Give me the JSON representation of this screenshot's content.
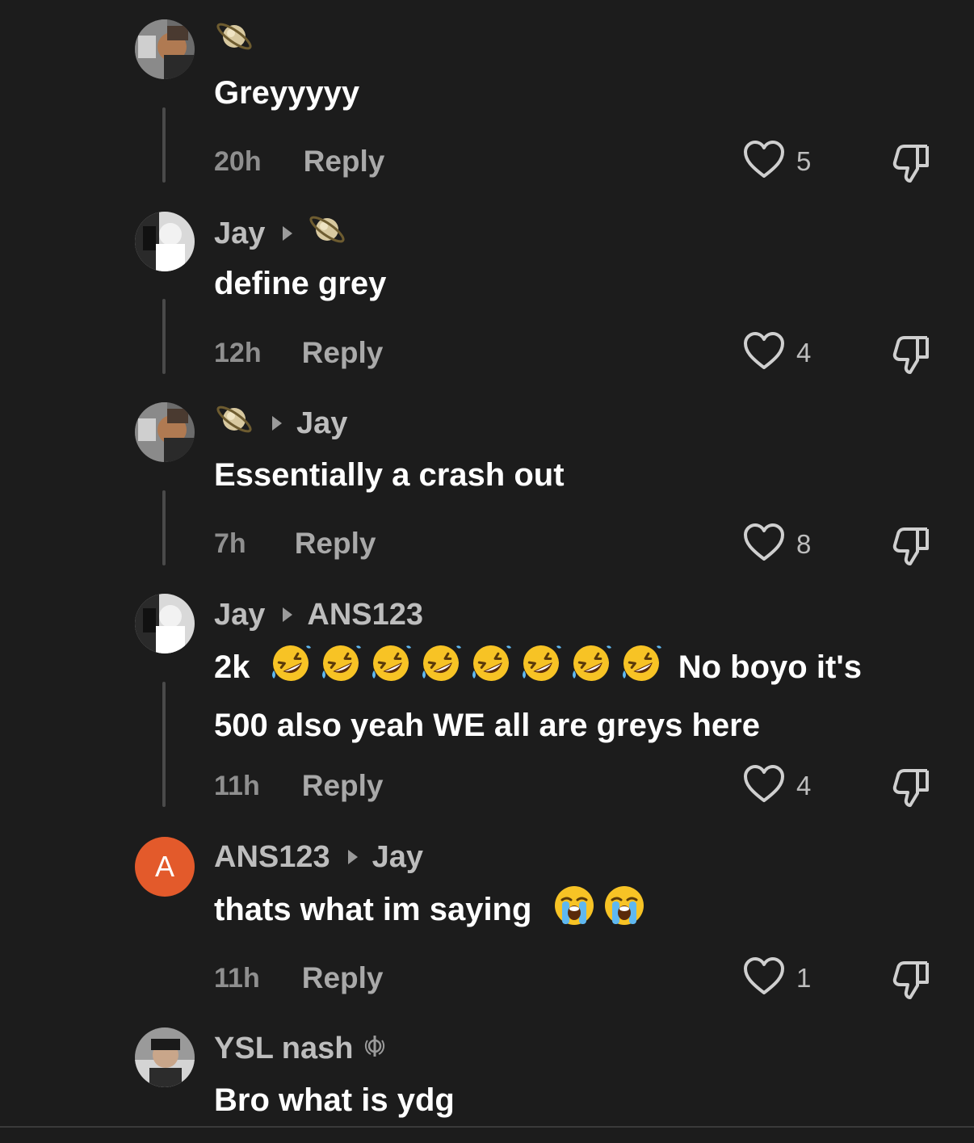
{
  "comments": [
    {
      "author": "",
      "author_icon": "planet-emoji",
      "text": "Greyyyyy",
      "time": "20h",
      "reply_label": "Reply",
      "likes": "5"
    },
    {
      "author": "Jay",
      "reply_to_icon": "planet-emoji",
      "text": "define grey",
      "time": "12h",
      "reply_label": "Reply",
      "likes": "4"
    },
    {
      "author_icon": "planet-emoji",
      "reply_to": "Jay",
      "text": "Essentially a crash out",
      "time": "7h",
      "reply_label": "Reply",
      "likes": "8"
    },
    {
      "author": "Jay",
      "reply_to": "ANS123",
      "text_prefix": "2k",
      "emoji_count": 8,
      "emoji_name": "rolling-on-floor-laughing",
      "text_suffix": "No boyo it's",
      "text_line2": "500 also yeah WE all are greys here",
      "time": "11h",
      "reply_label": "Reply",
      "likes": "4"
    },
    {
      "author": "ANS123",
      "avatar_letter": "A",
      "reply_to": "Jay",
      "text": "thats what im saying",
      "emoji_name": "loudly-crying-face",
      "emoji_count": 2,
      "time": "11h",
      "reply_label": "Reply",
      "likes": "1"
    },
    {
      "author": "YSL nash",
      "author_badge_icon": "khanda-icon",
      "text": "Bro what is ydg"
    }
  ],
  "colors": {
    "background": "#1c1c1c",
    "avatar_letter_bg": "#e35a2b",
    "text_primary": "#ffffff",
    "text_secondary": "#bdbdbd",
    "text_muted": "#8f8f8f"
  }
}
